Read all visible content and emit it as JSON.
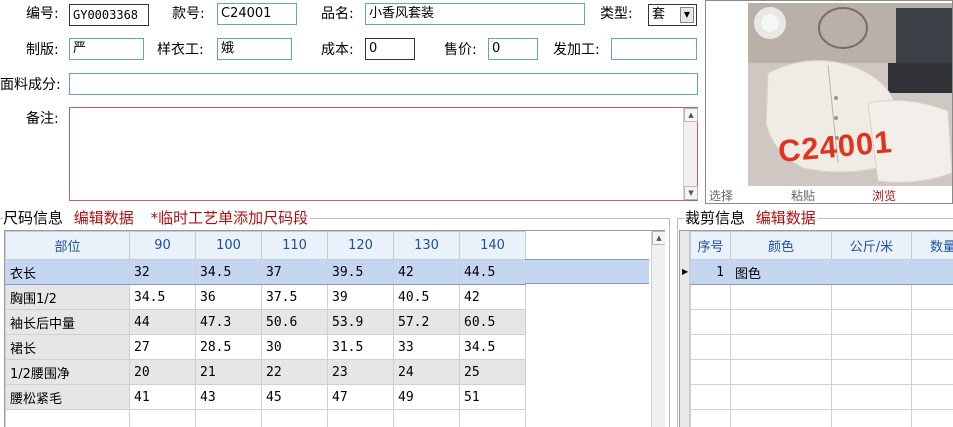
{
  "form": {
    "bianhao_label": "编号:",
    "bianhao_value": "GY0003368",
    "kuanhao_label": "款号:",
    "kuanhao_value": "C24001",
    "pinming_label": "品名:",
    "pinming_value": "小香风套装",
    "leixing_label": "类型:",
    "leixing_value": "套",
    "zhiban_label": "制版:",
    "zhiban_value": "严",
    "yangyigong_label": "样衣工:",
    "yangyigong_value": "娥",
    "chengben_label": "成本:",
    "chengben_value": "0",
    "shoujia_label": "售价:",
    "shoujia_value": "0",
    "fajiagong_label": "发加工:",
    "fajiagong_value": "",
    "mianliao_label": "面料成分:",
    "mianliao_value": "",
    "beizhu_label": "备注:",
    "beizhu_value": ""
  },
  "image_panel": {
    "overlay_text": "C24001",
    "select_label": "选择",
    "paste_label": "粘贴",
    "browse_label": "浏览"
  },
  "size_section": {
    "title": "尺码信息",
    "edit_link": "编辑数据",
    "note": "*临时工艺单添加尺码段",
    "headers": [
      "部位",
      "90",
      "100",
      "110",
      "120",
      "130",
      "140"
    ],
    "rows": [
      [
        "衣长",
        "32",
        "34.5",
        "37",
        "39.5",
        "42",
        "44.5"
      ],
      [
        "胸围1/2",
        "34.5",
        "36",
        "37.5",
        "39",
        "40.5",
        "42"
      ],
      [
        "袖长后中量",
        "44",
        "47.3",
        "50.6",
        "53.9",
        "57.2",
        "60.5"
      ],
      [
        "裙长",
        "27",
        "28.5",
        "30",
        "31.5",
        "33",
        "34.5"
      ],
      [
        "1/2腰围净",
        "20",
        "21",
        "22",
        "23",
        "24",
        "25"
      ],
      [
        "腰松紧毛",
        "41",
        "43",
        "45",
        "47",
        "49",
        "51"
      ]
    ]
  },
  "cut_section": {
    "title": "裁剪信息",
    "edit_link": "编辑数据",
    "headers": [
      "序号",
      "颜色",
      "公斤/米",
      "数量"
    ],
    "rows": [
      [
        "1",
        "图色",
        "",
        ""
      ]
    ]
  },
  "colors": {
    "field_border": "#5aa8c8",
    "grid_header_bg": "#e9f1fb",
    "grid_header_text": "#1f4f9a",
    "selected_row": "#c5d6f1",
    "accent_red": "#b01010"
  }
}
